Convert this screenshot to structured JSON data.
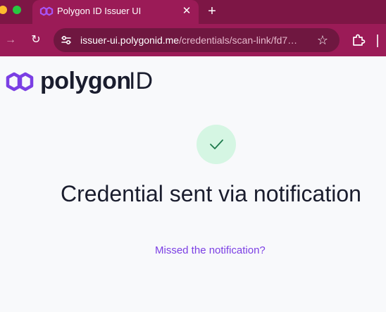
{
  "browser": {
    "tab": {
      "title": "Polygon ID Issuer UI",
      "close_glyph": "✕",
      "favicon": "polygon-favicon-icon"
    },
    "new_tab_glyph": "+",
    "nav": {
      "forward_glyph": "→",
      "reload_glyph": "↻"
    },
    "omnibox": {
      "domain": "issuer-ui.polygonid.me",
      "path": "/credentials/scan-link/fd7…",
      "star_glyph": "☆"
    },
    "colors": {
      "tabstrip": "#7d1645",
      "toolbar": "#9b1b57",
      "omnibox": "#6f1740"
    }
  },
  "page": {
    "logo": {
      "wordmark": "polygon",
      "suffix": "ID",
      "color": "#7b3fe4"
    },
    "status_icon": "checkmark-icon",
    "headline": "Credential sent via notification",
    "missed_link": "Missed the notification?",
    "colors": {
      "success_bg": "#d5f6e3",
      "success_check": "#1e7a4c",
      "link": "#7b3fe4",
      "text": "#1a1d2e"
    }
  }
}
